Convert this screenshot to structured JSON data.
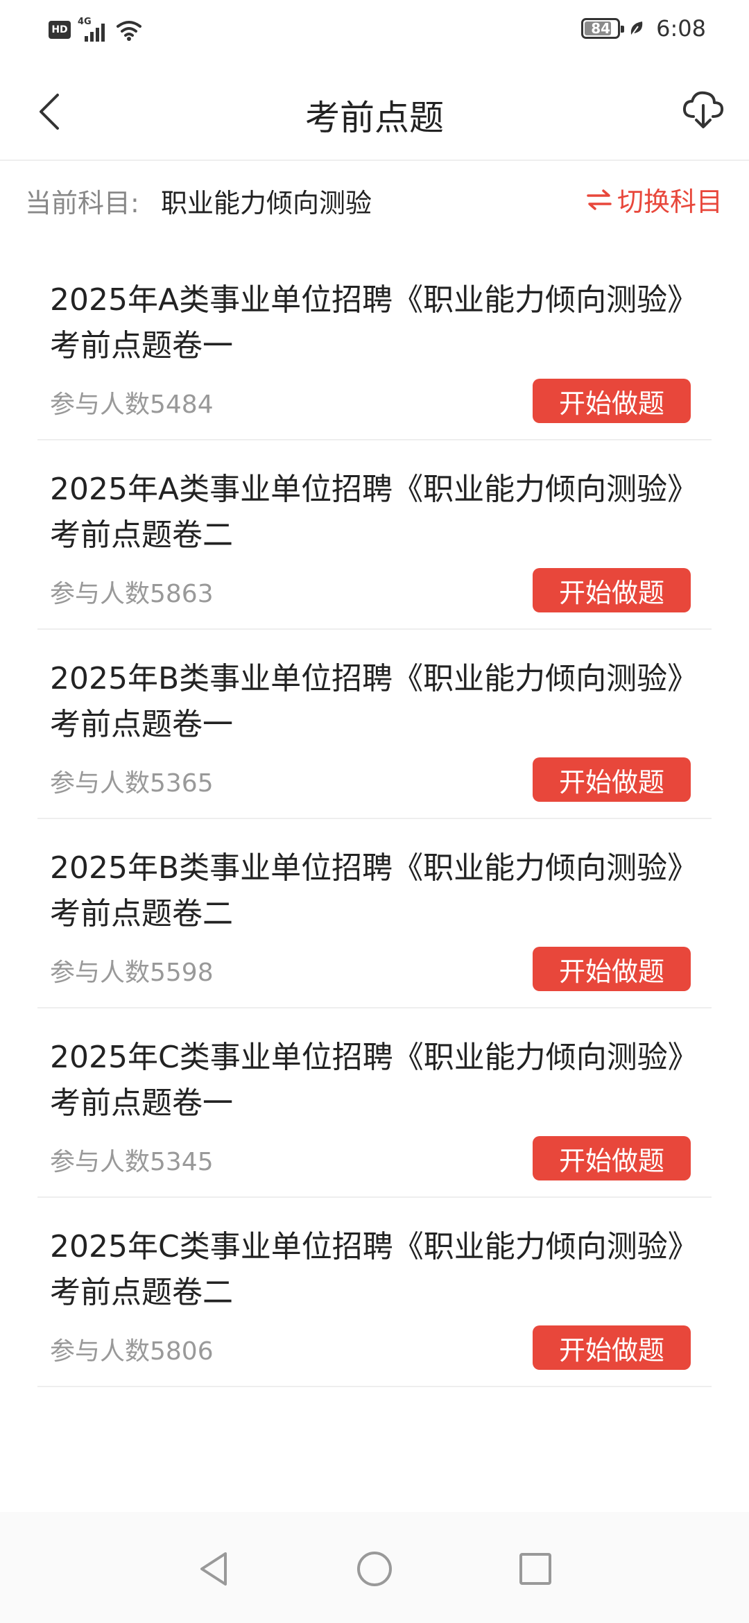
{
  "status_bar": {
    "hd": "HD",
    "network": "4G",
    "battery": "84",
    "battery_level": 0.84,
    "time": "6:08"
  },
  "header": {
    "title": "考前点题",
    "icons": {
      "back": "chevron-left-icon",
      "download": "cloud-download-icon"
    }
  },
  "subject": {
    "label": "当前科目:",
    "value": "职业能力倾向测验",
    "switch_label": "切换科目",
    "switch_icon": "swap-arrows-icon",
    "accent_color": "#e8473b"
  },
  "exams": [
    {
      "title": "2025年A类事业单位招聘《职业能力倾向测验》考前点题卷一",
      "count": "参与人数5484",
      "button": "开始做题"
    },
    {
      "title": "2025年A类事业单位招聘《职业能力倾向测验》考前点题卷二",
      "count": "参与人数5863",
      "button": "开始做题"
    },
    {
      "title": "2025年B类事业单位招聘《职业能力倾向测验》考前点题卷一",
      "count": "参与人数5365",
      "button": "开始做题"
    },
    {
      "title": "2025年B类事业单位招聘《职业能力倾向测验》考前点题卷二",
      "count": "参与人数5598",
      "button": "开始做题"
    },
    {
      "title": "2025年C类事业单位招聘《职业能力倾向测验》考前点题卷一",
      "count": "参与人数5345",
      "button": "开始做题"
    },
    {
      "title": "2025年C类事业单位招聘《职业能力倾向测验》考前点题卷二",
      "count": "参与人数5806",
      "button": "开始做题"
    }
  ],
  "nav_bar": {
    "icons": {
      "back": "triangle-back-icon",
      "home": "circle-home-icon",
      "recent": "square-recent-icon"
    }
  }
}
